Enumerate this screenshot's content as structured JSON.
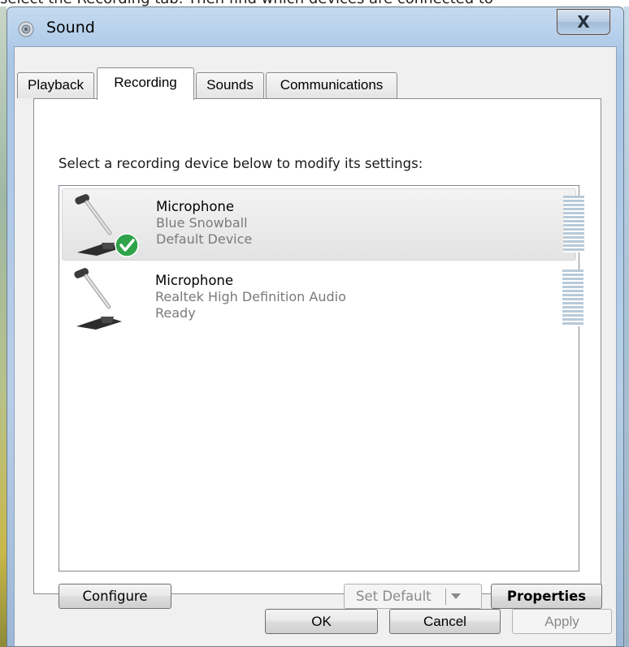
{
  "background": {
    "cutoff_text": "select the Recording tab. Then find which devices are connected to"
  },
  "window": {
    "title": "Sound",
    "close_label": "X"
  },
  "tabs": [
    {
      "label": "Playback",
      "active": false
    },
    {
      "label": "Recording",
      "active": true
    },
    {
      "label": "Sounds",
      "active": false
    },
    {
      "label": "Communications",
      "active": false
    }
  ],
  "recording": {
    "instruction": "Select a recording device below to modify its settings:",
    "devices": [
      {
        "name": "Microphone",
        "description": "Blue Snowball",
        "status": "Default Device",
        "default": true,
        "selected": true
      },
      {
        "name": "Microphone",
        "description": "Realtek High Definition Audio",
        "status": "Ready",
        "default": false,
        "selected": false
      }
    ],
    "buttons": {
      "configure": "Configure",
      "set_default": "Set Default",
      "properties": "Properties"
    }
  },
  "dialog_buttons": {
    "ok": "OK",
    "cancel": "Cancel",
    "apply": "Apply"
  },
  "colors": {
    "check_green": "#2fa34a",
    "meter_blue": "#b8cad9"
  },
  "icons": {
    "title": "speaker-icon",
    "device": "microphone-icon",
    "default_marker": "checkmark-icon"
  }
}
